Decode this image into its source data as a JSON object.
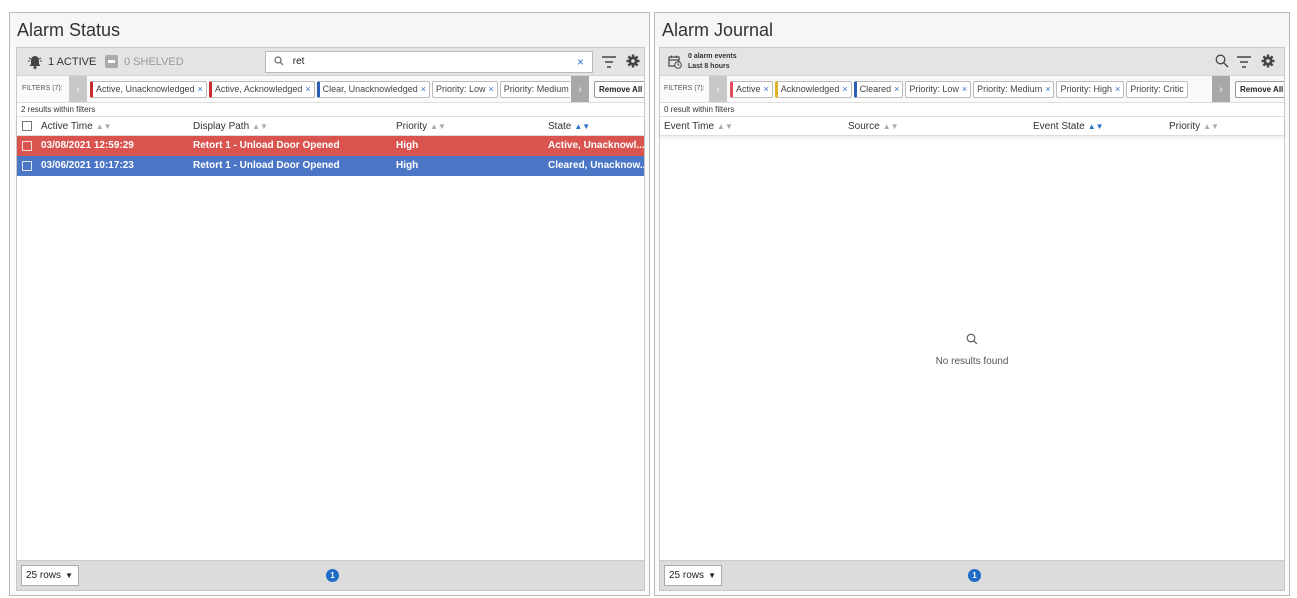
{
  "alarm_status": {
    "title": "Alarm Status",
    "active_label": "1 ACTIVE",
    "shelved_label": "0 SHELVED",
    "search_value": "ret",
    "filters_label": "FILTERS (7):",
    "chips": [
      {
        "label": "Active, Unacknowledged"
      },
      {
        "label": "Active, Acknowledged"
      },
      {
        "label": "Clear, Unacknowledged"
      },
      {
        "label": "Priority: Low"
      },
      {
        "label": "Priority: Medium"
      }
    ],
    "remove_all": "Remove All",
    "results": "2 results within filters",
    "columns": [
      "Active Time",
      "Display Path",
      "Priority",
      "State"
    ],
    "rows": [
      {
        "time": "03/08/2021 12:59:29",
        "path": "Retort 1 - Unload Door Opened",
        "priority": "High",
        "state": "Active, Unacknowl..."
      },
      {
        "time": "03/06/2021 10:17:23",
        "path": "Retort 1 - Unload Door Opened",
        "priority": "High",
        "state": "Cleared, Unacknow..."
      }
    ],
    "rows_per_page": "25 rows",
    "page": "1"
  },
  "alarm_journal": {
    "title": "Alarm Journal",
    "events_label": "0 alarm events",
    "range_label": "Last 8 hours",
    "filters_label": "FILTERS (7):",
    "chips": [
      {
        "label": "Active"
      },
      {
        "label": "Acknowledged"
      },
      {
        "label": "Cleared"
      },
      {
        "label": "Priority: Low"
      },
      {
        "label": "Priority: Medium"
      },
      {
        "label": "Priority: High"
      },
      {
        "label": "Priority: Critic"
      }
    ],
    "remove_all": "Remove All",
    "results": "0 result within filters",
    "columns": [
      "Event Time",
      "Source",
      "Event State",
      "Priority"
    ],
    "empty": "No results found",
    "rows_per_page": "25 rows",
    "page": "1"
  },
  "colors": {
    "active_unack": "#d9534f",
    "cleared_unack": "#4a76c5",
    "accent": "#1e6cc7"
  }
}
